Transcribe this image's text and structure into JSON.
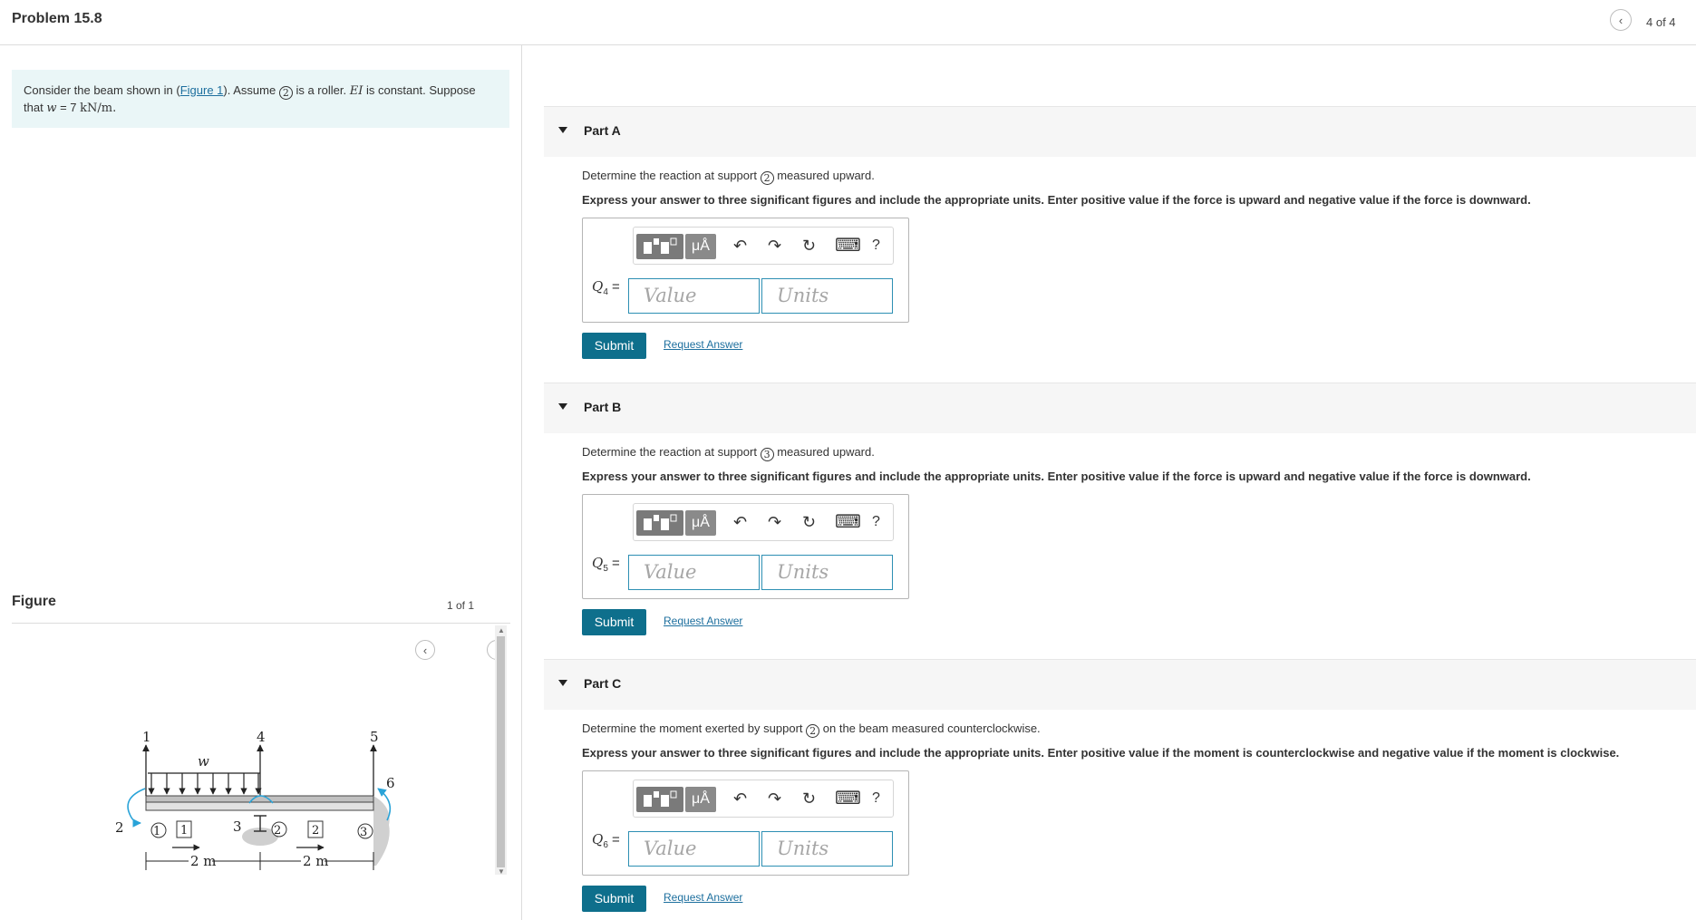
{
  "header": {
    "title": "Problem 15.8",
    "page_counter": "4 of 4"
  },
  "intro": {
    "text_before_link": "Consider the beam shown in (",
    "link": "Figure 1",
    "text_after_link": "). Assume",
    "support_number": "2",
    "text_mid": "is a roller.",
    "ei": "EI",
    "text_end": "is constant. Suppose",
    "line2_prefix": "that",
    "w_symbol": "w",
    "w_value": "= 7",
    "w_units": "kN/m."
  },
  "figure": {
    "title": "Figure",
    "counter": "1 of 1",
    "labels": {
      "n1": "1",
      "n2": "2",
      "n3": "3",
      "n4": "4",
      "n5": "5",
      "n6": "6",
      "load": "w",
      "node_a": "1",
      "node_b": "2",
      "node_c": "3",
      "elem_a": "1",
      "elem_b": "2",
      "dim_a": "2 m",
      "dim_b": "2 m"
    }
  },
  "toolbar": {
    "units_glyph": "μÅ",
    "undo": "↶",
    "redo": "↷",
    "reset": "↻",
    "keyboard": "⌨",
    "help": "?"
  },
  "parts": [
    {
      "label": "Part A",
      "question_prefix": "Determine the reaction at support",
      "support": "2",
      "question_suffix": "measured upward.",
      "instruction": "Express your answer to three significant figures and include the appropriate units. Enter positive value if the force is upward and negative value if the force is downward.",
      "var": "Q",
      "var_sub": "4",
      "value_placeholder": "Value",
      "units_placeholder": "Units",
      "submit": "Submit",
      "request": "Request Answer"
    },
    {
      "label": "Part B",
      "question_prefix": "Determine the reaction at support",
      "support": "3",
      "question_suffix": "measured upward.",
      "instruction": "Express your answer to three significant figures and include the appropriate units. Enter positive value if the force is upward and negative value if the force is downward.",
      "var": "Q",
      "var_sub": "5",
      "value_placeholder": "Value",
      "units_placeholder": "Units",
      "submit": "Submit",
      "request": "Request Answer"
    },
    {
      "label": "Part C",
      "question_prefix": "Determine the moment exerted by support",
      "support": "2",
      "question_suffix": "on the beam measured counterclockwise.",
      "instruction": "Express your answer to three significant figures and include the appropriate units. Enter positive value if the moment is counterclockwise and negative value if the moment is clockwise.",
      "var": "Q",
      "var_sub": "6",
      "value_placeholder": "Value",
      "units_placeholder": "Units",
      "submit": "Submit",
      "request": "Request Answer"
    }
  ]
}
